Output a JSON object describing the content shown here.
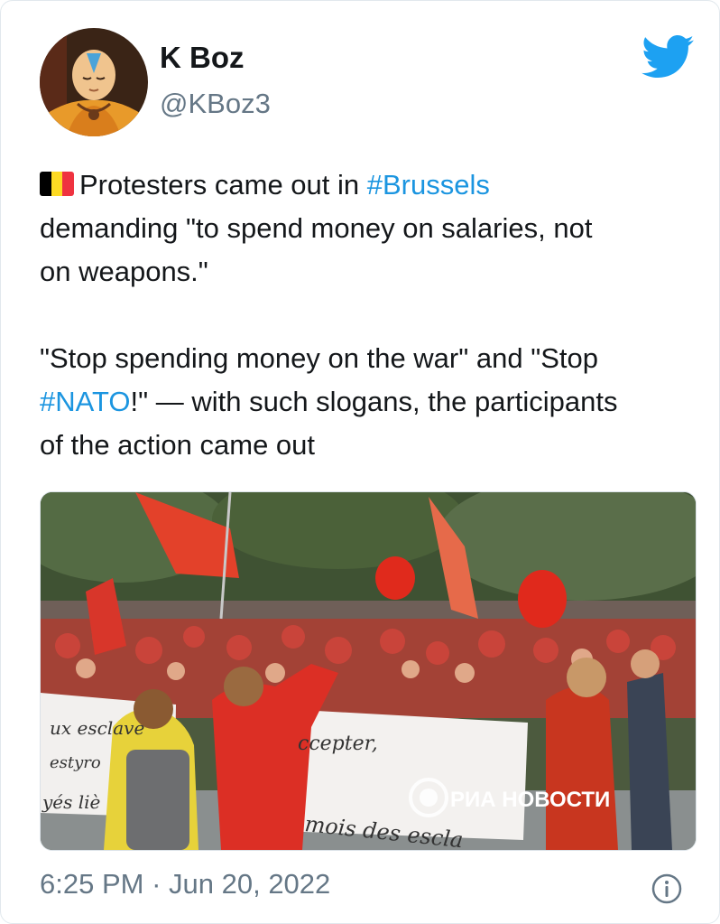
{
  "user": {
    "name": "K Boz",
    "handle": "@KBoz3"
  },
  "tweet": {
    "line1_before": "Protesters came out in ",
    "line1_hashtag": "#Brussels",
    "line2": "demanding \"to spend money on salaries, not",
    "line3": "on weapons.\"",
    "line4": "\"Stop spending money on the war\" and \"Stop",
    "line5_hashtag": "#NATO",
    "line5_after": "!\" — with such slogans, the participants",
    "line6": "of the action came out",
    "flag_colors": [
      "#000000",
      "#fdda24",
      "#ef3340"
    ]
  },
  "media": {
    "banner_left": [
      "ux esclave",
      "estyro",
      "yés liè"
    ],
    "banner_middle": "ccepter,",
    "banner_bottom": "mois des escla",
    "watermark": "РИА НОВОСТИ"
  },
  "meta": {
    "time": "6:25 PM",
    "separator": " · ",
    "date": "Jun 20, 2022"
  },
  "colors": {
    "accent": "#1da1f2",
    "hashtag": "#1b95e0",
    "secondary_text": "#657786"
  },
  "icons": [
    "twitter-bird-icon",
    "info-icon"
  ]
}
